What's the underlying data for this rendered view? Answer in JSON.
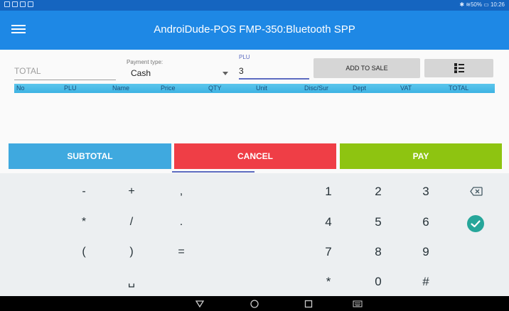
{
  "status_bar": {
    "left_icons": [
      "sim-icon",
      "cloud-icon",
      "gallery-icon",
      "upload-icon"
    ],
    "right_text": "✱ ≋50% ▭ 10:26"
  },
  "app_bar": {
    "title": "AndroiDude-POS   FMP-350:Bluetooth SPP",
    "menu_icon": "hamburger-menu-icon"
  },
  "form": {
    "total_placeholder": "TOTAL",
    "payment_type_label": "Payment type:",
    "payment_type_value": "Cash",
    "plu_label": "PLU",
    "plu_value": "3",
    "add_to_sale_label": "ADD TO SALE",
    "list_icon": "list-view-icon"
  },
  "table": {
    "headers": [
      "No",
      "PLU",
      "Name",
      "Price",
      "QTY",
      "Unit",
      "Disc/Sur",
      "Dept",
      "VAT",
      "TOTAL"
    ],
    "rows": []
  },
  "actions": {
    "subtotal": "SUBTOTAL",
    "cancel": "CANCEL",
    "pay": "PAY"
  },
  "keyboard": {
    "symbols": [
      [
        "-",
        "+",
        ","
      ],
      [
        "*",
        "/",
        "."
      ],
      [
        "(",
        ")",
        "="
      ],
      [
        "",
        "␣",
        ""
      ]
    ],
    "digits": [
      [
        "1",
        "2",
        "3"
      ],
      [
        "4",
        "5",
        "6"
      ],
      [
        "7",
        "8",
        "9"
      ],
      [
        "*",
        "0",
        "#"
      ]
    ],
    "backspace_icon": "backspace-icon",
    "confirm_icon": "check-circle-icon"
  },
  "nav_bar": {
    "icons": [
      "back-triangle-icon",
      "home-circle-icon",
      "recents-square-icon",
      "keyboard-icon"
    ]
  },
  "colors": {
    "status_bar": "#1565c0",
    "app_bar": "#1e88e5",
    "subtotal": "#3fa9df",
    "cancel": "#ef3e46",
    "pay": "#8ec411",
    "accent": "#5c6bc0",
    "confirm": "#26a69a"
  }
}
